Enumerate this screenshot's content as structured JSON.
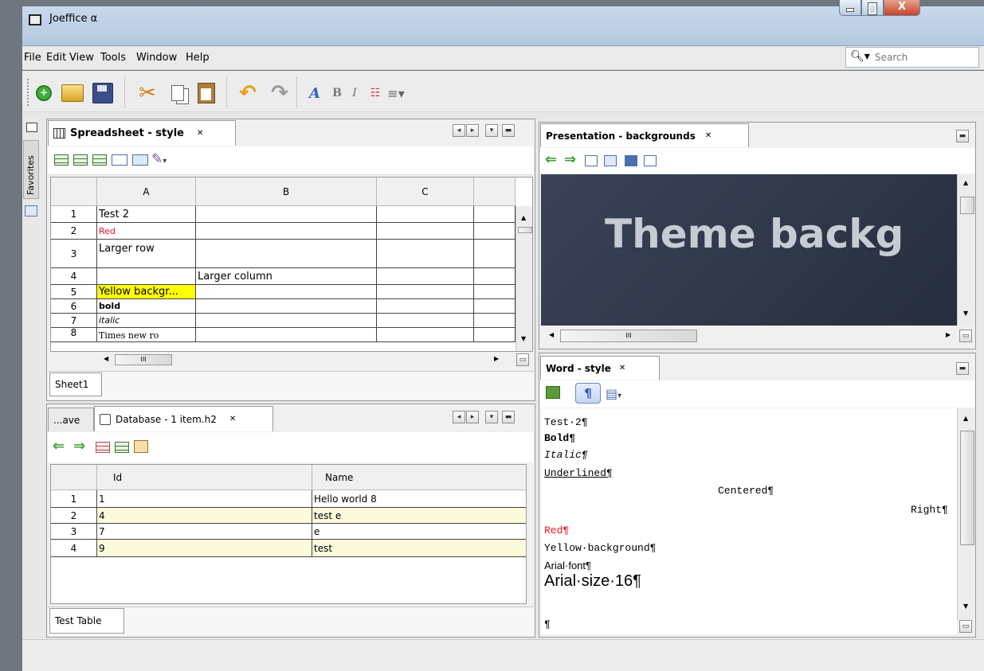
{
  "window": {
    "title": "Joeffice α",
    "close_glyph": "X"
  },
  "menu": [
    "File",
    "Edit",
    "View",
    "Tools",
    "Window",
    "Help"
  ],
  "search": {
    "placeholder": "Search"
  },
  "sidebar": {
    "favorites_label": "Favorites"
  },
  "spreadsheet": {
    "tab_title": "Spreadsheet - style",
    "columns": [
      "A",
      "B",
      "C"
    ],
    "rows": [
      {
        "num": "1",
        "a": "Test 2",
        "b": ""
      },
      {
        "num": "2",
        "a": "Red",
        "b": ""
      },
      {
        "num": "3",
        "a": "Larger row",
        "b": ""
      },
      {
        "num": "4",
        "a": "",
        "b": "Larger column"
      },
      {
        "num": "5",
        "a": "Yellow backgr...",
        "b": ""
      },
      {
        "num": "6",
        "a": "bold",
        "b": ""
      },
      {
        "num": "7",
        "a": "italic",
        "b": ""
      },
      {
        "num": "8",
        "a": "Times new ro",
        "b": ""
      }
    ],
    "scroll_mark": "III",
    "sheet_tab": "Sheet1"
  },
  "database": {
    "prev_tab": "...ave",
    "tab_title": "Database - 1 item.h2",
    "columns": [
      "Id",
      "Name"
    ],
    "rows": [
      {
        "num": "1",
        "id": "1",
        "name": "Hello world 8"
      },
      {
        "num": "2",
        "id": "4",
        "name": "test e"
      },
      {
        "num": "3",
        "id": "7",
        "name": "e"
      },
      {
        "num": "4",
        "id": "9",
        "name": "test"
      }
    ],
    "table_tab": "Test Table"
  },
  "presentation": {
    "tab_title": "Presentation - backgrounds",
    "slide_text": "Theme backg",
    "scroll_mark": "III"
  },
  "word": {
    "tab_title": "Word - style",
    "lines": {
      "test2": "Test·2¶",
      "bold": "Bold¶",
      "italic": "Italic¶",
      "underlined": "Underlined¶",
      "centered": "Centered¶",
      "right": "Right¶",
      "red": "Red¶",
      "yellow": "Yellow·background¶",
      "arial": "Arial·font¶",
      "arial16": "Arial·size·16¶",
      "empty": "¶"
    }
  },
  "colors": {
    "red_text": "#e8141c",
    "yellow_bg": "#ffff00",
    "db_alt_row": "#fbfbdc",
    "slide_bg": "#2e3647",
    "slide_text": "#c7cbd3"
  }
}
